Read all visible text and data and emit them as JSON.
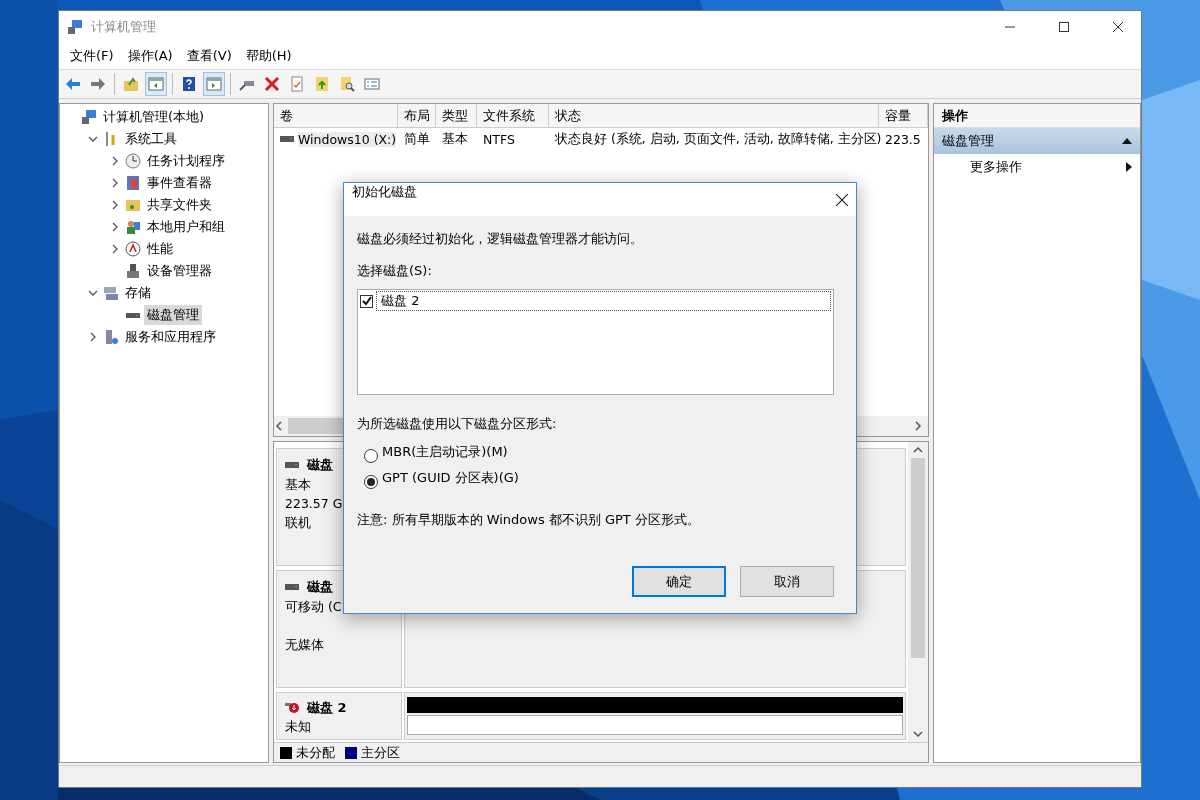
{
  "window": {
    "title": "计算机管理"
  },
  "menu": [
    "文件(F)",
    "操作(A)",
    "查看(V)",
    "帮助(H)"
  ],
  "toolbar": [
    {
      "kind": "back",
      "pressed": false
    },
    {
      "kind": "forward",
      "pressed": false
    },
    {
      "kind": "sep"
    },
    {
      "kind": "up",
      "pressed": false
    },
    {
      "kind": "panel",
      "pressed": true
    },
    {
      "kind": "sep"
    },
    {
      "kind": "help",
      "pressed": false
    },
    {
      "kind": "panel2",
      "pressed": true
    },
    {
      "kind": "sep"
    },
    {
      "kind": "plug",
      "pressed": false
    },
    {
      "kind": "delete",
      "pressed": false
    },
    {
      "kind": "check",
      "pressed": false
    },
    {
      "kind": "folderup",
      "pressed": false
    },
    {
      "kind": "find",
      "pressed": false
    },
    {
      "kind": "list",
      "pressed": false
    }
  ],
  "tree": [
    {
      "label": "计算机管理(本地)",
      "selected": false,
      "children": [
        {
          "label": "系统工具",
          "expanded": true,
          "selected": false,
          "children": [
            {
              "label": "任务计划程序",
              "expanded": false,
              "selected": false
            },
            {
              "label": "事件查看器",
              "expanded": false,
              "selected": false
            },
            {
              "label": "共享文件夹",
              "expanded": false,
              "selected": false
            },
            {
              "label": "本地用户和组",
              "expanded": false,
              "selected": false
            },
            {
              "label": "性能",
              "expanded": false,
              "selected": false
            },
            {
              "label": "设备管理器",
              "selected": false
            }
          ]
        },
        {
          "label": "存储",
          "expanded": true,
          "selected": false,
          "children": [
            {
              "label": "磁盘管理",
              "selected": true
            }
          ]
        },
        {
          "label": "服务和应用程序",
          "expanded": false,
          "selected": false
        }
      ]
    }
  ],
  "volumes": {
    "columns": [
      "卷",
      "布局",
      "类型",
      "文件系统",
      "状态",
      "容量"
    ],
    "rows": [
      [
        "Windows10 (X:)",
        "简单",
        "基本",
        "NTFS",
        "状态良好 (系统, 启动, 页面文件, 活动, 故障转储, 主分区)",
        "223.5"
      ]
    ]
  },
  "disks": [
    {
      "kind": "basic",
      "name": "磁盘",
      "type": "基本",
      "size": "223.57 G",
      "status": "联机"
    },
    {
      "kind": "removable",
      "name": "磁盘",
      "type": "可移动 (C",
      "status": "无媒体"
    },
    {
      "kind": "unknown",
      "name": "磁盘 2",
      "type": "未知"
    }
  ],
  "legend": [
    {
      "label": "未分配",
      "color": "#000000"
    },
    {
      "label": "主分区",
      "color": "#000080"
    }
  ],
  "actions": {
    "title": "操作",
    "section": "磁盘管理",
    "items": [
      "更多操作"
    ]
  },
  "dialog": {
    "title": "初始化磁盘",
    "message": "磁盘必须经过初始化，逻辑磁盘管理器才能访问。",
    "list_label": "选择磁盘(S):",
    "disks": [
      {
        "label": "磁盘 2",
        "checked": true
      }
    ],
    "style_label": "为所选磁盘使用以下磁盘分区形式:",
    "options": [
      {
        "label": "MBR(主启动记录)(M)",
        "selected": false
      },
      {
        "label": "GPT (GUID 分区表)(G)",
        "selected": true
      }
    ],
    "note": "注意: 所有早期版本的 Windows 都不识别 GPT 分区形式。",
    "buttons": [
      {
        "label": "确定",
        "default": true
      },
      {
        "label": "取消",
        "default": false
      }
    ]
  }
}
